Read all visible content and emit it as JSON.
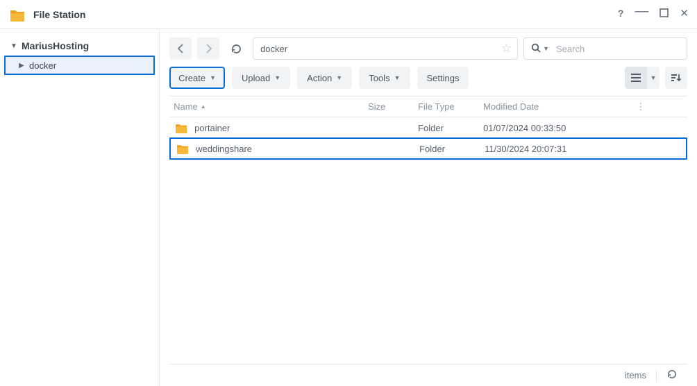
{
  "app": {
    "title": "File Station"
  },
  "sidebar": {
    "root": {
      "label": "MariusHosting"
    },
    "child": {
      "label": "docker"
    }
  },
  "toolbar": {
    "path": "docker",
    "search_placeholder": "Search",
    "create": "Create",
    "upload": "Upload",
    "action": "Action",
    "tools": "Tools",
    "settings": "Settings"
  },
  "columns": {
    "name": "Name",
    "size": "Size",
    "file_type": "File Type",
    "modified": "Modified Date"
  },
  "rows": [
    {
      "name": "portainer",
      "size": "",
      "type": "Folder",
      "modified": "01/07/2024 00:33:50",
      "selected": false
    },
    {
      "name": "weddingshare",
      "size": "",
      "type": "Folder",
      "modified": "11/30/2024 20:07:31",
      "selected": true
    }
  ],
  "status": {
    "items_label": "items"
  }
}
